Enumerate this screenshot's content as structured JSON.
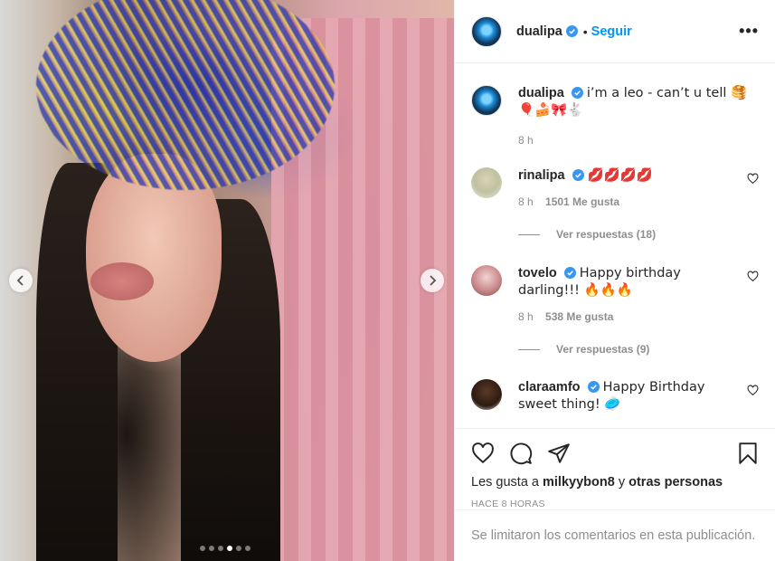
{
  "post": {
    "carousel_total": 6,
    "carousel_active": 4
  },
  "header": {
    "username": "dualipa",
    "follow_label": "Seguir",
    "more_label": "•••"
  },
  "caption": {
    "username": "dualipa",
    "text": "i’m a leo - can’t u tell 🥞🎈🍰🎀🐇",
    "time": "8 h"
  },
  "comments": [
    {
      "username": "rinalipa",
      "text": "💋💋💋💋",
      "time": "8 h",
      "likes": "1501 Me gusta",
      "replies": "Ver respuestas (18)"
    },
    {
      "username": "tovelo",
      "text": "Happy birthday darling!!! 🔥🔥🔥",
      "time": "8 h",
      "likes": "538 Me gusta",
      "replies": "Ver respuestas (9)"
    },
    {
      "username": "claraamfo",
      "text": "Happy Birthday sweet thing! 🥏"
    }
  ],
  "actions": {
    "liked_prefix": "Les gusta a",
    "liked_user": "milkyybon8",
    "liked_and": "y",
    "liked_others": "otras personas",
    "timestamp": "HACE 8 HORAS"
  },
  "footer": {
    "limited_text": "Se limitaron los comentarios en esta publicación."
  },
  "colors": {
    "accent": "#0095f6",
    "verified": "#3897f0"
  }
}
